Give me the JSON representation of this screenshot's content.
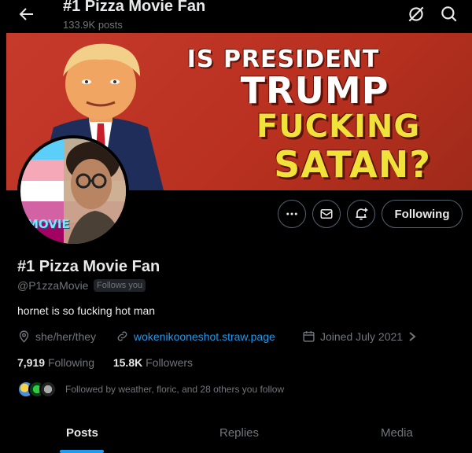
{
  "header": {
    "title": "#1 Pizza Movie Fan",
    "post_count": "133.9K posts"
  },
  "banner": {
    "line1": "IS PRESIDENT",
    "line2": "TRUMP",
    "line3": "FUCKING",
    "line4": "SATAN?"
  },
  "avatar": {
    "logo_text": "MOVIE",
    "flag_colors": [
      "#5bcefa",
      "#f5a9b8",
      "#ffffff",
      "#d362a4",
      "#a30262"
    ]
  },
  "actions": {
    "following_label": "Following"
  },
  "profile": {
    "name": "#1 Pizza Movie Fan",
    "handle": "@P1zzaMovie",
    "follows_you": "Follows you",
    "bio": "hornet is so fucking hot man",
    "pronouns": "she/her/they",
    "website": "wokenikooneshot.straw.page",
    "joined": "Joined July 2021"
  },
  "stats": {
    "following_count": "7,919",
    "following_label": "Following",
    "followers_count": "15.8K",
    "followers_label": "Followers"
  },
  "followed_by": {
    "text": "Followed by weather, floric, and 28 others you follow"
  },
  "tabs": [
    {
      "label": "Posts"
    },
    {
      "label": "Replies"
    },
    {
      "label": "Media"
    }
  ],
  "colors": {
    "accent": "#1d9bf0",
    "background": "#000000",
    "muted_text": "#71767b",
    "primary_text": "#e7e9ea"
  }
}
